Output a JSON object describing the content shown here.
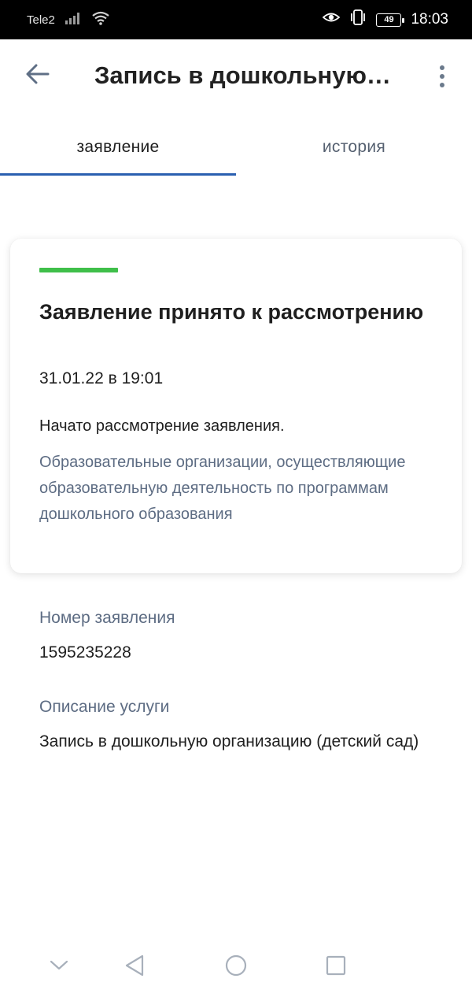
{
  "status_bar": {
    "carrier": "Tele2",
    "battery_level": "49",
    "time": "18:03",
    "icons": [
      "signal-icon",
      "wifi-icon",
      "eye-icon",
      "vibrate-icon",
      "battery-icon"
    ]
  },
  "header": {
    "title": "Запись в дошкольную…",
    "back_icon": "arrow-left-icon",
    "menu_icon": "more-vertical-icon"
  },
  "tabs": [
    {
      "label": "заявление",
      "active": true
    },
    {
      "label": "история",
      "active": false
    }
  ],
  "status_card": {
    "status_color": "#3fbf4a",
    "title": "Заявление принято к рассмотрению",
    "datetime": "31.01.22 в 19:01",
    "message": "Начато рассмотрение заявления.",
    "organization": "Образовательные организации, осуществляющие образовательную деятельность по программам дошкольного образования"
  },
  "details": {
    "number_label": "Номер заявления",
    "number_value": "1595235228",
    "service_label": "Описание услуги",
    "service_value": "Запись в дошкольную организацию (детский сад)"
  },
  "colors": {
    "accent": "#2a5fb0",
    "secondary_text": "#5d6c83",
    "success": "#3fbf4a"
  },
  "nav_bar": {
    "icons": [
      "chevron-down-icon",
      "back-triangle-icon",
      "home-circle-icon",
      "recents-square-icon"
    ]
  }
}
